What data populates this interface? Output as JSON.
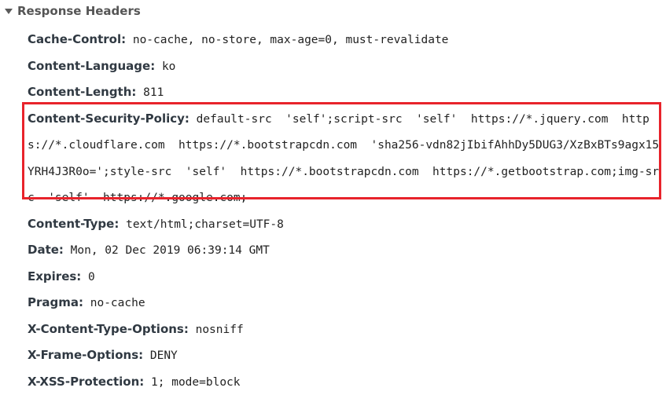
{
  "section": {
    "title": "Response Headers"
  },
  "headers": [
    {
      "name": "Cache-Control:",
      "value": " no-cache, no-store, max-age=0, must-revalidate"
    },
    {
      "name": "Content-Language:",
      "value": " ko"
    },
    {
      "name": "Content-Length:",
      "value": " 811"
    },
    {
      "name": "Content-Security-Policy:",
      "value": " default-src  'self';script-src  'self'  https://*.jquery.com  https://*.cloudflare.com  https://*.bootstrapcdn.com  'sha256-vdn82jIbifAhhDy5DUG3/XzBxBTs9agx15YRH4J3R0o=';style-src  'self'  https://*.bootstrapcdn.com  https://*.getbootstrap.com;img-src  'self'  https://*.google.com;"
    },
    {
      "name": "Content-Type:",
      "value": " text/html;charset=UTF-8"
    },
    {
      "name": "Date:",
      "value": " Mon, 02 Dec 2019 06:39:14 GMT"
    },
    {
      "name": "Expires:",
      "value": " 0"
    },
    {
      "name": "Pragma:",
      "value": " no-cache"
    },
    {
      "name": "X-Content-Type-Options:",
      "value": " nosniff"
    },
    {
      "name": "X-Frame-Options:",
      "value": " DENY"
    },
    {
      "name": "X-XSS-Protection:",
      "value": " 1; mode=block"
    }
  ],
  "highlight_color": "#e8232b"
}
